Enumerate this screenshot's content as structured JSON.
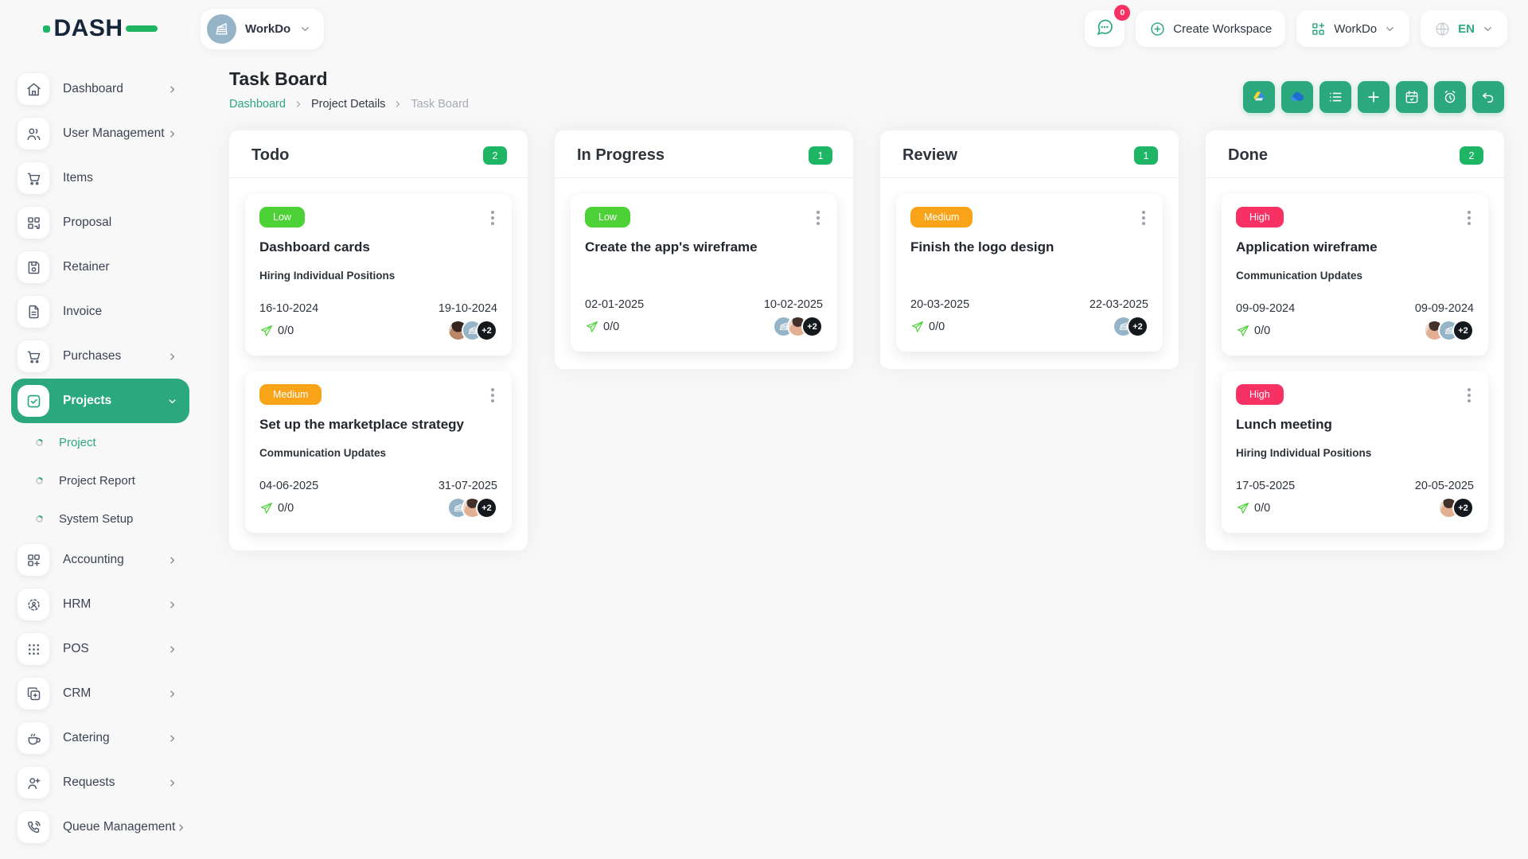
{
  "theme": {
    "primary_green": "#2ca87f",
    "badge_green": "#1eb564",
    "priority_colors": {
      "Low": "#4cd137",
      "Medium": "#f9a319",
      "High": "#f73164"
    },
    "avatar_teal": "#96b4c8",
    "high_badge_pink": "#f73164"
  },
  "brand": {
    "logo_text": "DASH"
  },
  "topbar": {
    "workspace": {
      "label": "WorkDo"
    },
    "chat": {
      "badge": "0"
    },
    "create_workspace_label": "Create Workspace",
    "app_switcher_label": "WorkDo",
    "language": {
      "code": "EN"
    }
  },
  "sidebar": {
    "items": [
      {
        "label": "Dashboard",
        "icon": "home-icon",
        "chevron": true
      },
      {
        "label": "User Management",
        "icon": "users-icon",
        "chevron": true
      },
      {
        "label": "Items",
        "icon": "cart-icon",
        "chevron": false
      },
      {
        "label": "Proposal",
        "icon": "qr-icon",
        "chevron": false
      },
      {
        "label": "Retainer",
        "icon": "save-icon",
        "chevron": false
      },
      {
        "label": "Invoice",
        "icon": "invoice-icon",
        "chevron": false
      },
      {
        "label": "Purchases",
        "icon": "cart-icon",
        "chevron": true
      },
      {
        "label": "Projects",
        "icon": "check-square-icon",
        "chevron": true,
        "active": true,
        "expanded": true,
        "submenu": [
          {
            "label": "Project",
            "active": true
          },
          {
            "label": "Project Report",
            "active": false
          },
          {
            "label": "System Setup",
            "active": false
          }
        ]
      },
      {
        "label": "Accounting",
        "icon": "grid-plus-icon",
        "chevron": true
      },
      {
        "label": "HRM",
        "icon": "hrm-icon",
        "chevron": true
      },
      {
        "label": "POS",
        "icon": "dots-grid-icon",
        "chevron": true
      },
      {
        "label": "CRM",
        "icon": "crm-icon",
        "chevron": true
      },
      {
        "label": "Catering",
        "icon": "coffee-icon",
        "chevron": true
      },
      {
        "label": "Requests",
        "icon": "user-plus-icon",
        "chevron": true
      },
      {
        "label": "Queue Management",
        "icon": "phone-icon",
        "chevron": true
      }
    ]
  },
  "page": {
    "title": "Task Board",
    "breadcrumb": [
      {
        "label": "Dashboard",
        "style": "link"
      },
      {
        "label": "Project Details",
        "style": "dark"
      },
      {
        "label": "Task Board",
        "style": "muted"
      }
    ]
  },
  "toolbar": {
    "buttons": [
      {
        "name": "google-drive-button",
        "icon": "google-drive-icon"
      },
      {
        "name": "onedrive-button",
        "icon": "onedrive-icon"
      },
      {
        "name": "list-view-button",
        "icon": "list-icon"
      },
      {
        "name": "add-task-button",
        "icon": "plus-icon"
      },
      {
        "name": "calendar-button",
        "icon": "calendar-icon"
      },
      {
        "name": "timer-button",
        "icon": "alarm-icon"
      },
      {
        "name": "back-button",
        "icon": "undo-icon"
      }
    ]
  },
  "board": {
    "columns": [
      {
        "title": "Todo",
        "count": "2",
        "cards": [
          {
            "priority": "Low",
            "title": "Dashboard cards",
            "milestone": "Hiring Individual Positions",
            "start_date": "16-10-2024",
            "end_date": "19-10-2024",
            "progress": "0/0",
            "avatars": [
              {
                "type": "photo-a"
              },
              {
                "type": "workdo"
              },
              {
                "type": "more",
                "label": "+2"
              }
            ]
          },
          {
            "priority": "Medium",
            "title": "Set up the marketplace strategy",
            "milestone": "Communication Updates",
            "start_date": "04-06-2025",
            "end_date": "31-07-2025",
            "progress": "0/0",
            "avatars": [
              {
                "type": "workdo"
              },
              {
                "type": "photo-b"
              },
              {
                "type": "more",
                "label": "+2"
              }
            ]
          }
        ]
      },
      {
        "title": "In Progress",
        "count": "1",
        "cards": [
          {
            "priority": "Low",
            "title": "Create the app's wireframe",
            "milestone": "",
            "start_date": "02-01-2025",
            "end_date": "10-02-2025",
            "progress": "0/0",
            "avatars": [
              {
                "type": "workdo"
              },
              {
                "type": "photo-b"
              },
              {
                "type": "more",
                "label": "+2"
              }
            ]
          }
        ]
      },
      {
        "title": "Review",
        "count": "1",
        "cards": [
          {
            "priority": "Medium",
            "title": "Finish the logo design",
            "milestone": "",
            "start_date": "20-03-2025",
            "end_date": "22-03-2025",
            "progress": "0/0",
            "avatars": [
              {
                "type": "workdo"
              },
              {
                "type": "more",
                "label": "+2"
              }
            ]
          }
        ]
      },
      {
        "title": "Done",
        "count": "2",
        "cards": [
          {
            "priority": "High",
            "title": "Application wireframe",
            "milestone": "Communication Updates",
            "start_date": "09-09-2024",
            "end_date": "09-09-2024",
            "progress": "0/0",
            "avatars": [
              {
                "type": "photo-b"
              },
              {
                "type": "workdo"
              },
              {
                "type": "more",
                "label": "+2"
              }
            ]
          },
          {
            "priority": "High",
            "title": "Lunch meeting",
            "milestone": "Hiring Individual Positions",
            "start_date": "17-05-2025",
            "end_date": "20-05-2025",
            "progress": "0/0",
            "avatars": [
              {
                "type": "photo-b"
              },
              {
                "type": "more",
                "label": "+2"
              }
            ]
          }
        ]
      }
    ]
  }
}
